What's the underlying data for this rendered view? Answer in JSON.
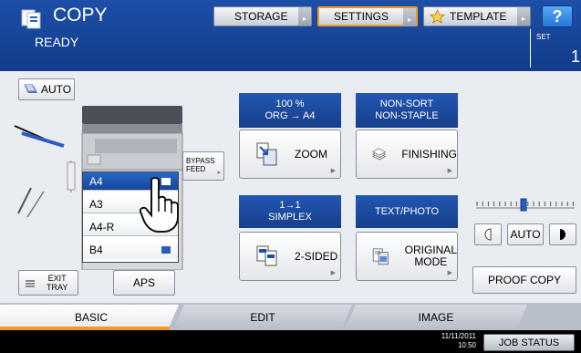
{
  "header": {
    "title": "COPY",
    "status": "READY",
    "buttons": [
      {
        "label": "STORAGE",
        "icon": "chevron-right-icon"
      },
      {
        "label": "SETTINGS",
        "icon": "chevron-right-icon"
      },
      {
        "label": "TEMPLATE",
        "icon": "star-icon"
      }
    ],
    "help_label": "?",
    "set_label": "SET",
    "set_count": "1"
  },
  "color_mode": {
    "label": "AUTO"
  },
  "paper": {
    "bypass_label": [
      "BYPASS",
      "FEED"
    ],
    "items": [
      {
        "label": "A4",
        "selected": true
      },
      {
        "label": "A3",
        "selected": false
      },
      {
        "label": "A4-R",
        "selected": false
      },
      {
        "label": "B4",
        "selected": false
      }
    ]
  },
  "exit_tray": {
    "label": [
      "EXIT",
      "TRAY"
    ]
  },
  "aps": {
    "label": "APS"
  },
  "functions": {
    "zoom": {
      "header": [
        "100 %",
        "ORG  →  A4"
      ],
      "label": "ZOOM"
    },
    "finishing": {
      "header": [
        "NON-SORT",
        "NON-STAPLE"
      ],
      "label": "FINISHING"
    },
    "duplex": {
      "header": [
        "1→1",
        "SIMPLEX"
      ],
      "label": "2-SIDED"
    },
    "original_mode": {
      "header": [
        "TEXT/PHOTO"
      ],
      "label": [
        "ORIGINAL",
        "MODE"
      ]
    }
  },
  "density": {
    "auto_label": "AUTO",
    "level": 0.5
  },
  "proof_copy": {
    "label": "PROOF COPY"
  },
  "tabs": [
    {
      "label": "BASIC",
      "active": true
    },
    {
      "label": "EDIT",
      "active": false
    },
    {
      "label": "IMAGE",
      "active": false
    }
  ],
  "footer": {
    "date": "11/11/2011",
    "time": "10:50",
    "job_status_label": "JOB STATUS"
  },
  "colors": {
    "header_blue": "#1d4fa8",
    "accent_orange": "#f39a1e",
    "selected_blue": "#15469a"
  }
}
